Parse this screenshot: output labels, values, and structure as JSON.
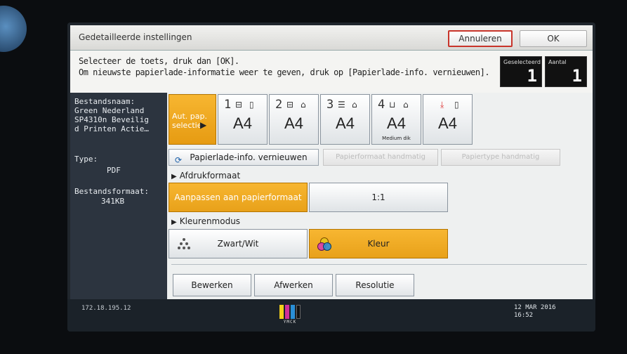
{
  "window": {
    "title": "Gedetailleerde instellingen",
    "cancel_label": "Annuleren",
    "ok_label": "OK"
  },
  "instructions": {
    "line1": "Selecteer de toets, druk dan [OK].",
    "line2": "Om nieuwste papierlade-informatie weer te geven, druk op [Papierlade-info. vernieuwen]."
  },
  "counters": {
    "selected_label": "Geselecteerd",
    "selected_value": "1",
    "count_label": "Aantal",
    "count_value": "1"
  },
  "file_info": {
    "name_label": "Bestandsnaam:",
    "name_lines": [
      "Green Nederland",
      "SP4310n Beveilig",
      "d Printen Actie…"
    ],
    "type_label": "Type:",
    "type_value": "PDF",
    "format_label": "Bestandsformaat:",
    "format_value": "341KB"
  },
  "trays": {
    "auto": {
      "label_line1": "Aut. pap.",
      "label_line2": "selectie"
    },
    "items": [
      {
        "num": "1",
        "size": "A4",
        "sub": ""
      },
      {
        "num": "2",
        "size": "A4",
        "sub": ""
      },
      {
        "num": "3",
        "size": "A4",
        "sub": ""
      },
      {
        "num": "4",
        "size": "A4",
        "sub": "Medium dik"
      },
      {
        "num": "",
        "size": "A4",
        "sub": ""
      }
    ]
  },
  "actions": {
    "refresh_label": "Papierlade-info. vernieuwen",
    "paper_size_manual": "Papierformaat handmatig",
    "paper_type_manual": "Papiertype handmatig"
  },
  "print_size": {
    "heading": "Afdrukformaat",
    "fit_label": "Aanpassen aan papierformaat",
    "one_to_one_label": "1:1"
  },
  "color_mode": {
    "heading": "Kleurenmodus",
    "bw_label": "Zwart/Wit",
    "color_label": "Kleur"
  },
  "tabs": {
    "edit": "Bewerken",
    "finish": "Afwerken",
    "resolution": "Resolutie"
  },
  "footer": {
    "ip": "172.18.195.12",
    "toner_label": "YMCK",
    "date": "12 MAR  2016",
    "time": "16:52"
  },
  "colors": {
    "accent_orange": "#f0a91f",
    "cancel_border": "#c8342a",
    "side_panel": "#2c343f"
  }
}
